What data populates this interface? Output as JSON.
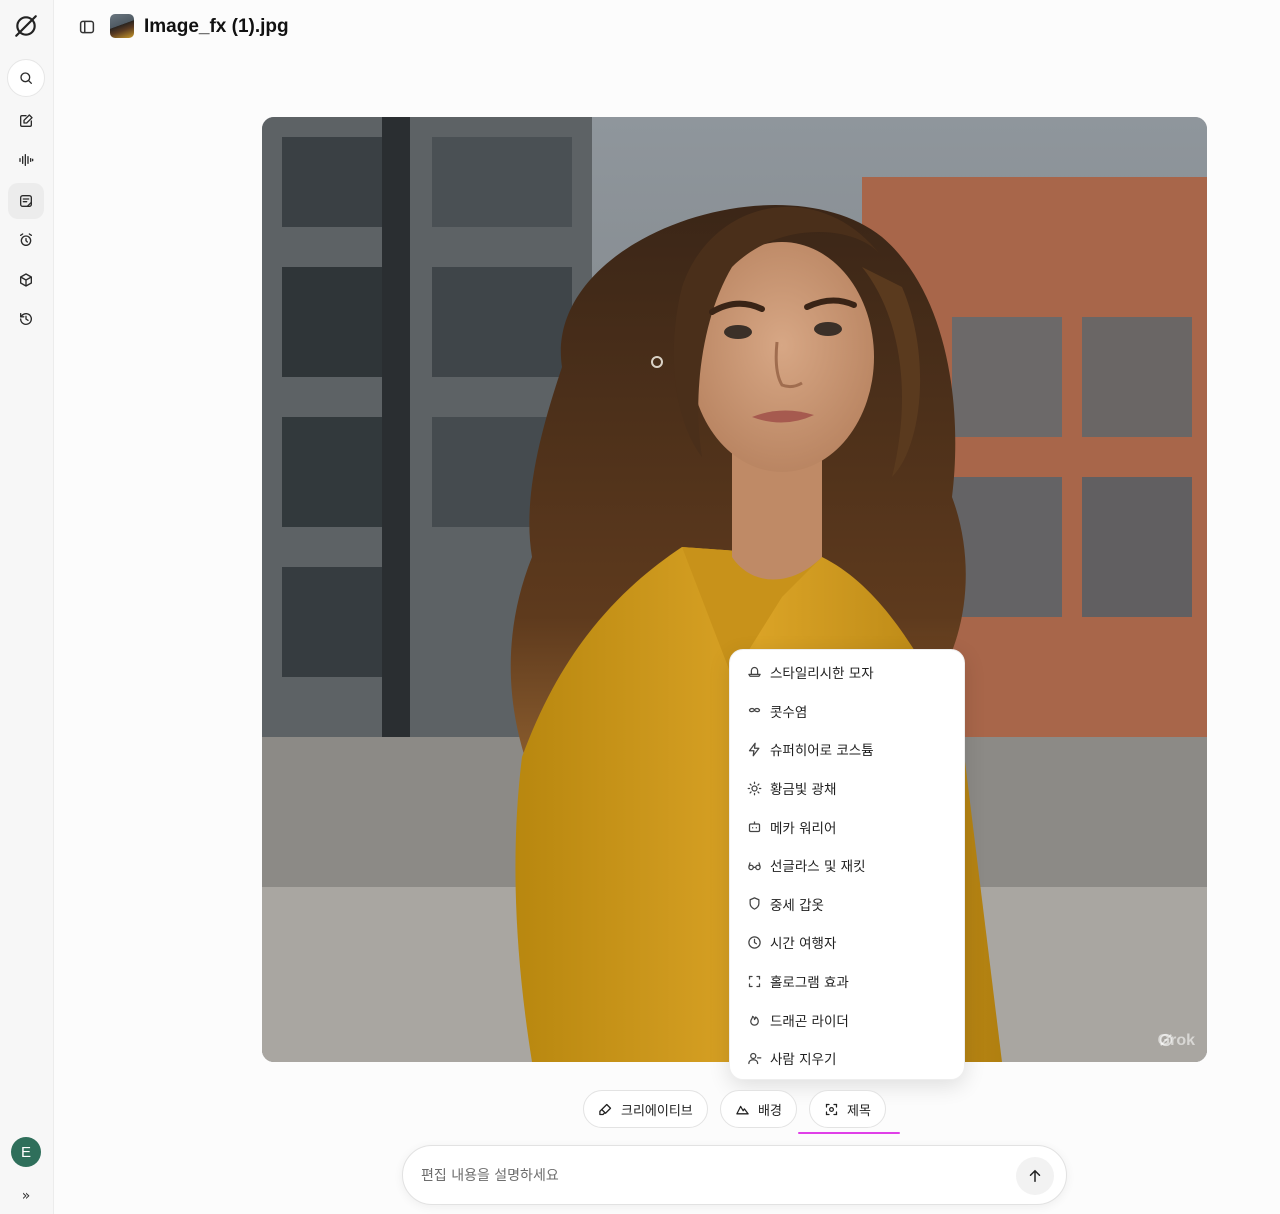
{
  "header": {
    "title": "Image_fx (1).jpg"
  },
  "sidebar": {
    "avatar_initial": "E",
    "items": [
      {
        "name": "logo",
        "icon": "grok-logo-icon"
      },
      {
        "name": "search",
        "icon": "search-icon"
      },
      {
        "name": "new-chat",
        "icon": "edit-icon"
      },
      {
        "name": "voice",
        "icon": "waveform-icon"
      },
      {
        "name": "imagine",
        "icon": "image-doc-icon",
        "active": true
      },
      {
        "name": "tasks",
        "icon": "alarm-icon"
      },
      {
        "name": "projects",
        "icon": "cube-icon"
      },
      {
        "name": "history",
        "icon": "history-icon"
      }
    ]
  },
  "image": {
    "watermark": "Grok"
  },
  "menu": {
    "items": [
      {
        "label": "스타일리시한 모자",
        "icon": "hat-icon"
      },
      {
        "label": "콧수염",
        "icon": "mustache-icon"
      },
      {
        "label": "슈퍼히어로 코스튬",
        "icon": "lightning-icon"
      },
      {
        "label": "황금빛 광채",
        "icon": "sun-icon"
      },
      {
        "label": "메카 워리어",
        "icon": "robot-icon"
      },
      {
        "label": "선글라스 및 재킷",
        "icon": "glasses-icon"
      },
      {
        "label": "중세 갑옷",
        "icon": "shield-icon"
      },
      {
        "label": "시간 여행자",
        "icon": "clock-icon"
      },
      {
        "label": "홀로그램 효과",
        "icon": "frame-corners-icon"
      },
      {
        "label": "드래곤 라이더",
        "icon": "flame-icon"
      },
      {
        "label": "사람 지우기",
        "icon": "person-remove-icon"
      }
    ]
  },
  "chips": {
    "creative": "크리에이티브",
    "background": "배경",
    "subject": "제목"
  },
  "prompt": {
    "placeholder": "편집 내용을 설명하세요"
  },
  "colors": {
    "underline": "#e040e8",
    "avatar": "#2f6f5b"
  }
}
